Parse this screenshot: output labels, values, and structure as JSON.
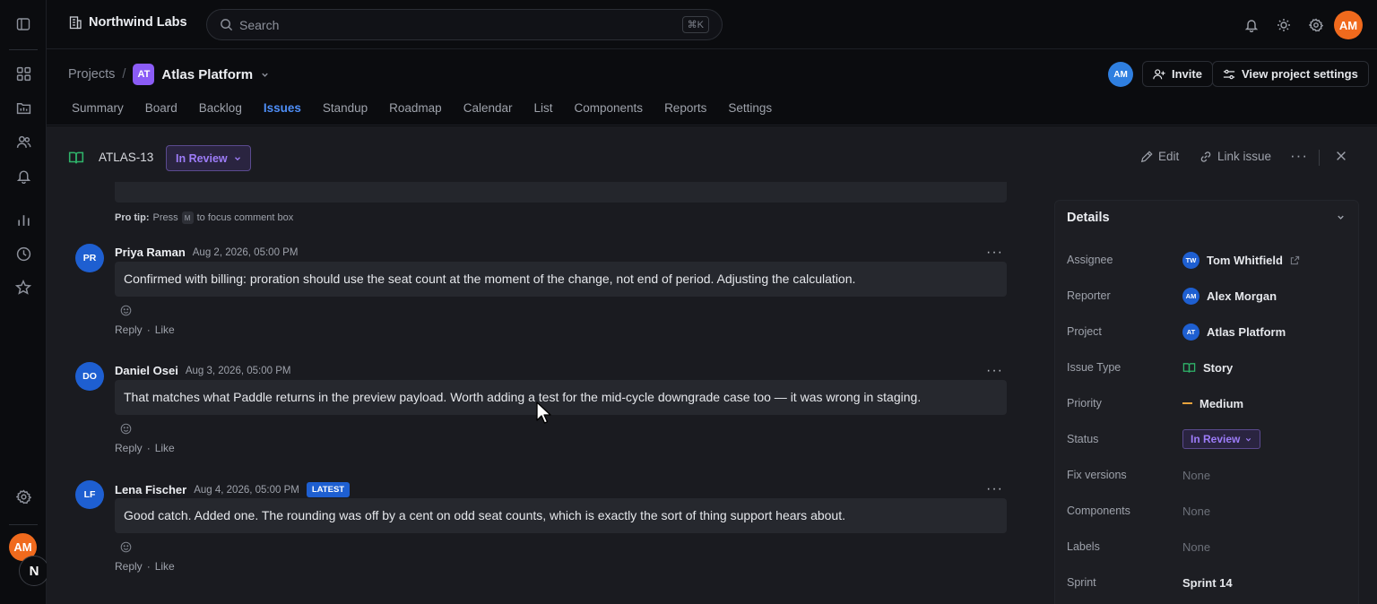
{
  "workspace": {
    "name": "Northwind Labs"
  },
  "search": {
    "placeholder": "Search",
    "shortcut": "⌘K"
  },
  "user": {
    "initials": "AM"
  },
  "rail": {
    "icons": [
      "sidebar-toggle-icon",
      "grid-icon",
      "folder-icon",
      "team-icon",
      "bell-icon",
      "chart-icon",
      "clock-icon",
      "star-icon",
      "settings-icon"
    ],
    "badge": "N"
  },
  "breadcrumb": {
    "root": "Projects",
    "separator": "/",
    "project_badge": "AT",
    "project_name": "Atlas Platform"
  },
  "header_actions": {
    "avatar": "AM",
    "invite_label": "Invite",
    "settings_label": "View project settings"
  },
  "tabs": [
    {
      "label": "Summary"
    },
    {
      "label": "Board"
    },
    {
      "label": "Backlog"
    },
    {
      "label": "Issues"
    },
    {
      "label": "Standup"
    },
    {
      "label": "Roadmap"
    },
    {
      "label": "Calendar"
    },
    {
      "label": "List"
    },
    {
      "label": "Components"
    },
    {
      "label": "Reports"
    },
    {
      "label": "Settings"
    }
  ],
  "active_tab": "Issues",
  "issue": {
    "key": "ATLAS-13",
    "status": "In Review",
    "actions": {
      "edit": "Edit",
      "link": "Link issue"
    }
  },
  "comment_box": {
    "protip_label": "Pro tip:",
    "protip_pre": "Press",
    "protip_key": "M",
    "protip_post": "to focus comment box"
  },
  "comments": [
    {
      "initials": "PR",
      "author": "Priya Raman",
      "time": "Aug 2, 2026, 05:00 PM",
      "badge": "",
      "text": "Confirmed with billing: proration should use the seat count at the moment of the change, not end of period. Adjusting the calculation.",
      "reply": "Reply",
      "like": "Like"
    },
    {
      "initials": "DO",
      "author": "Daniel Osei",
      "time": "Aug 3, 2026, 05:00 PM",
      "badge": "",
      "text": "That matches what Paddle returns in the preview payload. Worth adding a test for the mid-cycle downgrade case too — it was wrong in staging.",
      "reply": "Reply",
      "like": "Like"
    },
    {
      "initials": "LF",
      "author": "Lena Fischer",
      "time": "Aug 4, 2026, 05:00 PM",
      "badge": "LATEST",
      "text": "Good catch. Added one. The rounding was off by a cent on odd seat counts, which is exactly the sort of thing support hears about.",
      "reply": "Reply",
      "like": "Like"
    }
  ],
  "details": {
    "title": "Details",
    "rows": [
      {
        "label": "Assignee",
        "value": "Tom Whitfield",
        "avatar": "TW"
      },
      {
        "label": "Reporter",
        "value": "Alex Morgan",
        "avatar": "AM"
      },
      {
        "label": "Project",
        "value": "Atlas Platform",
        "avatar": "AT"
      },
      {
        "label": "Issue Type",
        "value": "Story"
      },
      {
        "label": "Priority",
        "value": "Medium"
      },
      {
        "label": "Status",
        "value": "In Review"
      },
      {
        "label": "Fix versions",
        "value": "None"
      },
      {
        "label": "Components",
        "value": "None"
      },
      {
        "label": "Labels",
        "value": "None"
      },
      {
        "label": "Sprint",
        "value": "Sprint 14"
      }
    ]
  },
  "colors": {
    "accent": "#4e8ef7",
    "status": "#9d7cf8",
    "avatar_orange": "#f06a1d",
    "story_green": "#2fb36a",
    "priority": "#e8a33d"
  }
}
